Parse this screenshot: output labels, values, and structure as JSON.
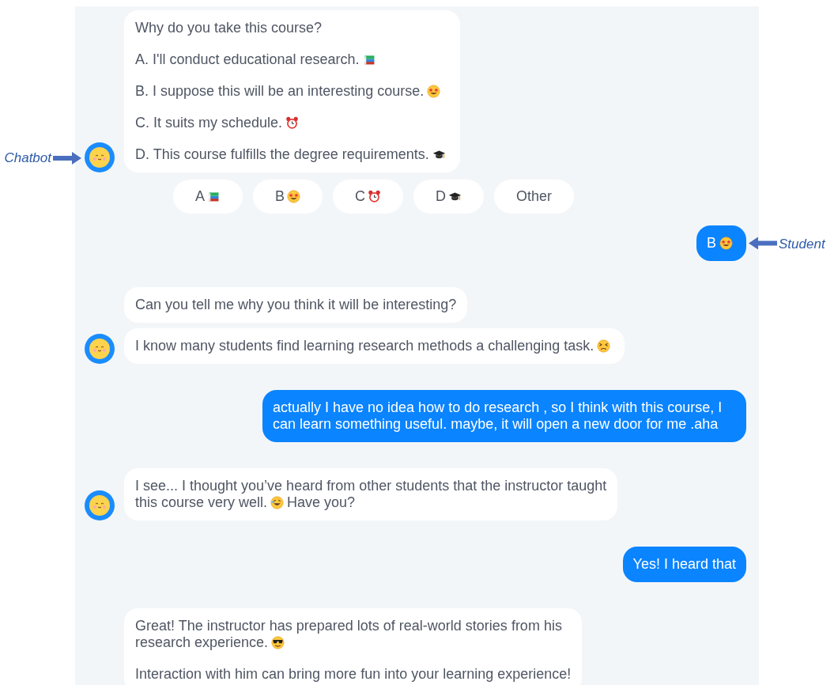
{
  "messages": [
    {
      "kind": "bot",
      "avatar": true,
      "annotation": "Chatbot",
      "bubbles": [
        {
          "paragraphs": [
            [
              [
                {
                  "kind": "text",
                  "text": "Why do you take this course?"
                }
              ]
            ],
            [
              [
                {
                  "kind": "text",
                  "text": "A. I'll conduct educational research."
                },
                {
                  "kind": "books"
                }
              ]
            ],
            [
              [
                {
                  "kind": "text",
                  "text": "B. I suppose this will be an interesting course."
                },
                {
                  "kind": "starstruck"
                }
              ]
            ],
            [
              [
                {
                  "kind": "text",
                  "text": "C. It suits my schedule."
                },
                {
                  "kind": "alarm"
                }
              ]
            ],
            [
              [
                {
                  "kind": "text",
                  "text": "D. This course fulfills the degree requirements."
                },
                {
                  "kind": "gradcap"
                }
              ]
            ]
          ]
        }
      ]
    },
    {
      "kind": "quick_replies",
      "options": [
        {
          "label": "A",
          "kind": "books"
        },
        {
          "label": "B",
          "kind": "starstruck"
        },
        {
          "label": "C",
          "kind": "alarm"
        },
        {
          "label": "D",
          "kind": "gradcap"
        },
        {
          "label": "Other",
          "kind": "text"
        }
      ]
    },
    {
      "kind": "student",
      "annotation": "Student",
      "bubbles": [
        {
          "paragraphs": [
            [
              [
                {
                  "kind": "text",
                  "text": "B"
                },
                {
                  "kind": "starstruck"
                }
              ]
            ]
          ]
        }
      ]
    },
    {
      "kind": "bot",
      "avatar": true,
      "bubbles": [
        {
          "paragraphs": [
            [
              [
                {
                  "kind": "text",
                  "text": "Can you tell me why you think it will be interesting?"
                }
              ]
            ]
          ]
        },
        {
          "paragraphs": [
            [
              [
                {
                  "kind": "text",
                  "text": "I know many students find learning research methods a challenging task."
                },
                {
                  "kind": "persevering"
                }
              ]
            ]
          ]
        }
      ]
    },
    {
      "kind": "student",
      "bubbles": [
        {
          "paragraphs": [
            [
              [
                {
                  "kind": "text",
                  "text": "actually I have no idea how to do research , so I think with this course, I can learn something useful. maybe, it will open a new door for me .aha"
                }
              ]
            ]
          ]
        }
      ]
    },
    {
      "kind": "bot",
      "avatar": true,
      "bubbles": [
        {
          "paragraphs": [
            [
              [
                {
                  "kind": "text",
                  "text": "I see... I thought you’ve heard from other students that the instructor taught"
                }
              ],
              [
                {
                  "kind": "text",
                  "text": "this course very well."
                },
                {
                  "kind": "rofl"
                },
                {
                  "kind": "text",
                  "text": "Have you?"
                }
              ]
            ]
          ]
        }
      ]
    },
    {
      "kind": "student",
      "bubbles": [
        {
          "paragraphs": [
            [
              [
                {
                  "kind": "text",
                  "text": "Yes! I heard that"
                }
              ]
            ]
          ]
        }
      ]
    },
    {
      "kind": "bot",
      "avatar": false,
      "bubbles": [
        {
          "paragraphs": [
            [
              [
                {
                  "kind": "text",
                  "text": "Great! The instructor has prepared lots of real-world stories from his"
                }
              ],
              [
                {
                  "kind": "text",
                  "text": "research experience."
                },
                {
                  "kind": "sunglasses"
                }
              ]
            ],
            [
              [
                {
                  "kind": "text",
                  "text": "Interaction with him can bring more fun into your learning experience!"
                }
              ]
            ]
          ]
        }
      ]
    }
  ]
}
